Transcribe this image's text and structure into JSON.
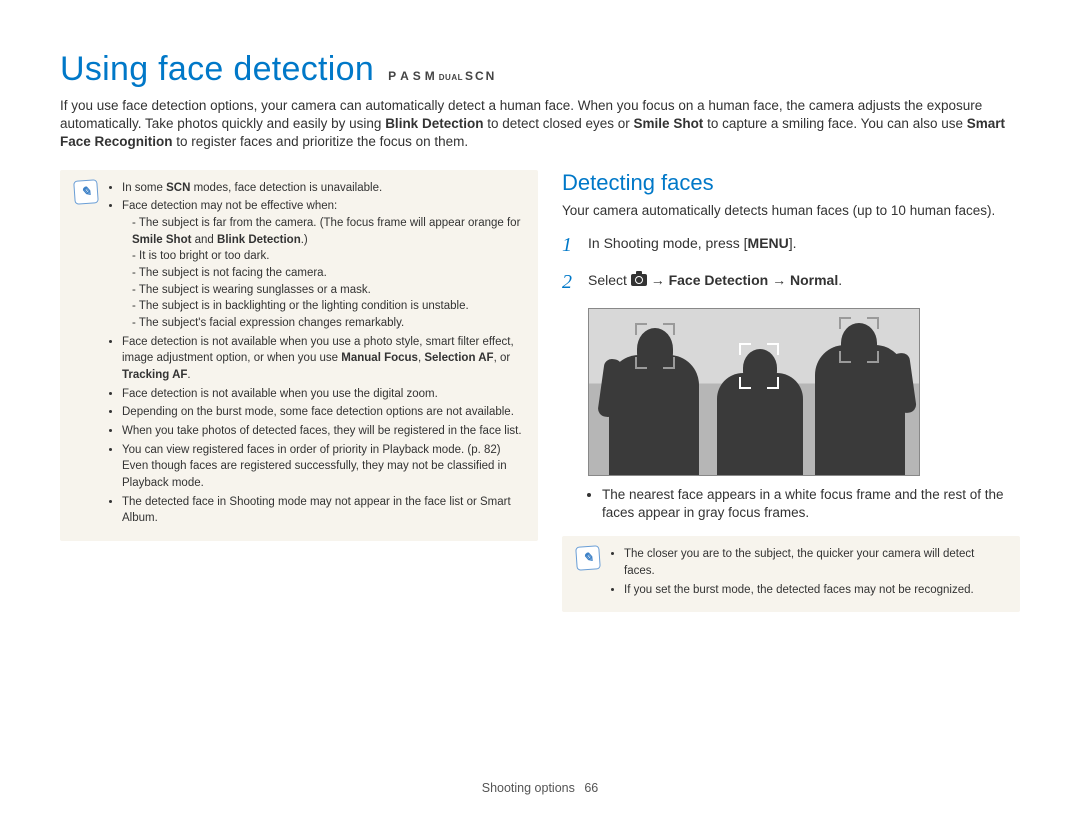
{
  "title": "Using face detection",
  "mode_letters": [
    "P",
    "A",
    "S",
    "M"
  ],
  "mode_small": "DUAL",
  "mode_scn": "SCN",
  "intro": {
    "t1": "If you use face detection options, your camera can automatically detect a human face. When you focus on a human face, the camera adjusts the exposure automatically. Take photos quickly and easily by using ",
    "b1": "Blink Detection",
    "t2": " to detect closed eyes or ",
    "b2": "Smile Shot",
    "t3": " to capture a smiling face. You can also use ",
    "b3": "Smart Face Recognition",
    "t4": " to register faces and prioritize the focus on them."
  },
  "left_note": {
    "items": [
      {
        "pre": "In some ",
        "scn": "SCN",
        "post": " modes, face detection is unavailable."
      },
      {
        "text": "Face detection may not be effective when:",
        "sub": [
          {
            "pre": "The subject is far from the camera. (The focus frame will appear orange for ",
            "b1": "Smile Shot",
            "mid": " and ",
            "b2": "Blink Detection",
            "post": ".)"
          },
          {
            "plain": "It is too bright or too dark."
          },
          {
            "plain": "The subject is not facing the camera."
          },
          {
            "plain": "The subject is wearing sunglasses or a mask."
          },
          {
            "plain": "The subject is in backlighting or the lighting condition is unstable."
          },
          {
            "plain": "The subject's facial expression changes remarkably."
          }
        ]
      },
      {
        "pre": "Face detection is not available when you use a photo style, smart filter effect, image adjustment option, or when you use ",
        "b1": "Manual Focus",
        "mid": ", ",
        "b2": "Selection AF",
        "mid2": ", or ",
        "b3": "Tracking AF",
        "post": "."
      },
      {
        "text": "Face detection is not available when you use the digital zoom."
      },
      {
        "text": "Depending on the burst mode, some face detection options are not available."
      },
      {
        "text": "When you take photos of detected faces, they will be registered in the face list."
      },
      {
        "text": "You can view registered faces in order of priority in Playback mode. (p. 82) Even though faces are registered successfully, they may not be classified in Playback mode."
      },
      {
        "text": "The detected face in Shooting mode may not appear in the face list or Smart Album."
      }
    ]
  },
  "right": {
    "heading": "Detecting faces",
    "body": "Your camera automatically detects human faces (up to 10 human faces).",
    "step1": {
      "num": "1",
      "t1": "In Shooting mode, press [",
      "key": "MENU",
      "t2": "]."
    },
    "step2": {
      "num": "2",
      "t1": "Select ",
      "arrow": " → ",
      "b1": "Face Detection",
      "b2": "Normal",
      "post": "."
    },
    "bullet": "The nearest face appears in a white focus frame and the rest of the faces appear in gray focus frames.",
    "tips": [
      "The closer you are to the subject, the quicker your camera will detect faces.",
      "If you set the burst mode, the detected faces may not be recognized."
    ]
  },
  "footer": {
    "section": "Shooting options",
    "page": "66"
  }
}
